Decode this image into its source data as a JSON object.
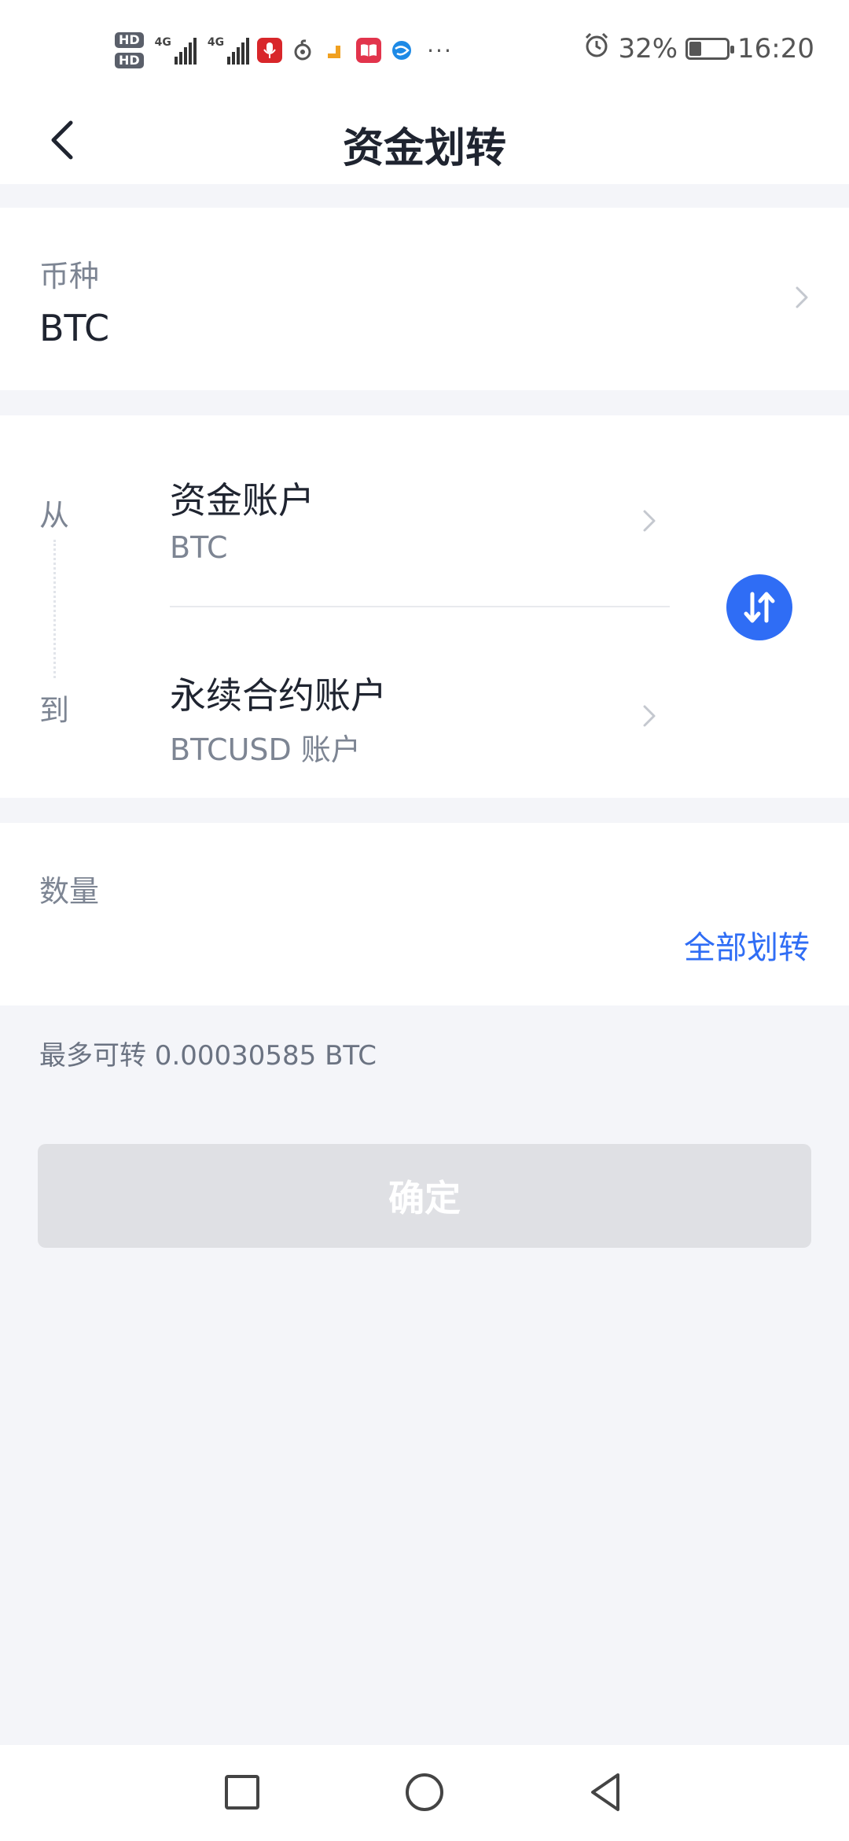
{
  "status_bar": {
    "hd1": "HD",
    "hd2": "HD",
    "signal1_label": "4G",
    "signal2_label": "4G",
    "more": "···",
    "battery": "32%",
    "time": "16:20"
  },
  "header": {
    "title": "资金划转"
  },
  "coin": {
    "label": "币种",
    "value": "BTC"
  },
  "transfer": {
    "from_label": "从",
    "to_label": "到",
    "from_account": "资金账户",
    "from_sub": "BTC",
    "to_account": "永续合约账户",
    "to_sub": "BTCUSD 账户"
  },
  "quantity": {
    "label": "数量",
    "input_value": "",
    "all_label": "全部划转"
  },
  "max_text": "最多可转 0.00030585 BTC",
  "confirm_label": "确定",
  "colors": {
    "accent": "#2f6df5",
    "background": "#f4f5f9",
    "disabled_button": "#dfe0e4"
  }
}
